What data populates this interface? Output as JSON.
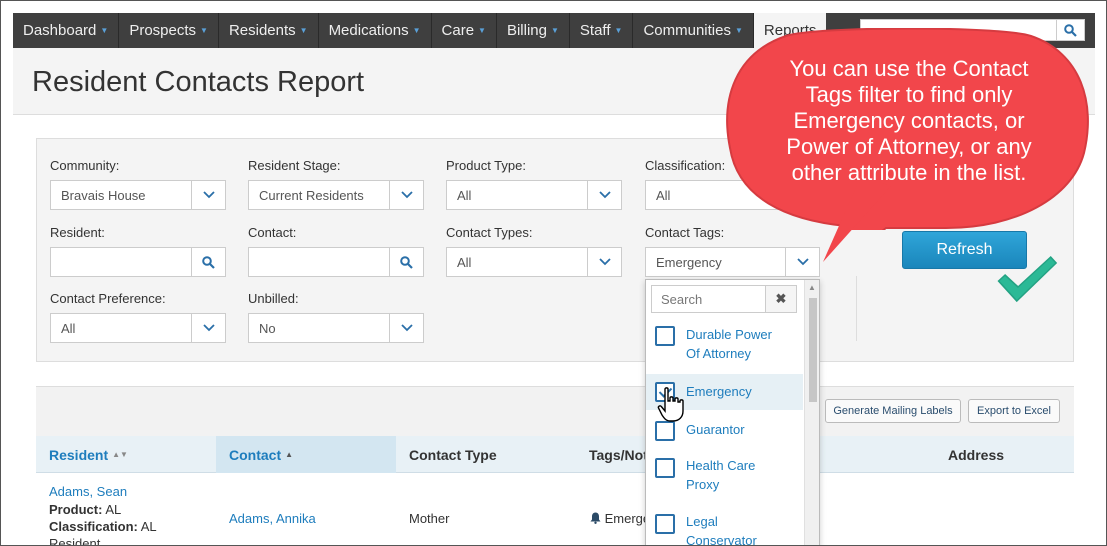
{
  "nav": {
    "tabs": [
      {
        "label": "Dashboard"
      },
      {
        "label": "Prospects"
      },
      {
        "label": "Residents"
      },
      {
        "label": "Medications"
      },
      {
        "label": "Care"
      },
      {
        "label": "Billing"
      },
      {
        "label": "Staff"
      },
      {
        "label": "Communities"
      },
      {
        "label": "Reports"
      }
    ],
    "search_icon": "search-icon"
  },
  "page": {
    "title": "Resident Contacts Report"
  },
  "filters": {
    "community": {
      "label": "Community:",
      "value": "Bravais House"
    },
    "resident_stage": {
      "label": "Resident Stage:",
      "value": "Current Residents"
    },
    "product_type": {
      "label": "Product Type:",
      "value": "All"
    },
    "classification": {
      "label": "Classification:",
      "value": "All"
    },
    "resident": {
      "label": "Resident:",
      "value": ""
    },
    "contact": {
      "label": "Contact:",
      "value": ""
    },
    "contact_types": {
      "label": "Contact Types:",
      "value": "All"
    },
    "contact_tags": {
      "label": "Contact Tags:",
      "value": "Emergency"
    },
    "contact_preference": {
      "label": "Contact Preference:",
      "value": "All"
    },
    "unbilled": {
      "label": "Unbilled:",
      "value": "No"
    }
  },
  "refresh_label": "Refresh",
  "toolbar": {
    "mailing_labels": "Generate Mailing Labels",
    "export": "Export to Excel"
  },
  "table": {
    "headers": {
      "resident": "Resident",
      "contact": "Contact",
      "contact_type": "Contact Type",
      "tags_notes": "Tags/Notes",
      "address": "Address"
    },
    "row": {
      "resident_name": "Adams, Sean",
      "product_label": "Product:",
      "product_value": "AL",
      "classification_label": "Classification:",
      "classification_value": "AL",
      "stage": "Resident",
      "contact_name": "Adams, Annika",
      "contact_type": "Mother",
      "tag": "Emergency"
    }
  },
  "dropdown": {
    "search_placeholder": "Search",
    "clear": "✖",
    "options": [
      {
        "label1": "Durable Power",
        "label2": "Of Attorney",
        "checked": false
      },
      {
        "label1": "Emergency",
        "label2": "",
        "checked": true
      },
      {
        "label1": "Guarantor",
        "label2": "",
        "checked": false
      },
      {
        "label1": "Health Care",
        "label2": "Proxy",
        "checked": false
      },
      {
        "label1": "Legal",
        "label2": "Conservator",
        "checked": false
      }
    ]
  },
  "callout": {
    "line1": "You can use the Contact",
    "line2": "Tags filter to find only",
    "line3": "Emergency contacts, or",
    "line4": "Power of Attorney, or any",
    "line5": "other attribute in the list.",
    "color": "#f2464b"
  },
  "checkmark_color": "#2bb996"
}
